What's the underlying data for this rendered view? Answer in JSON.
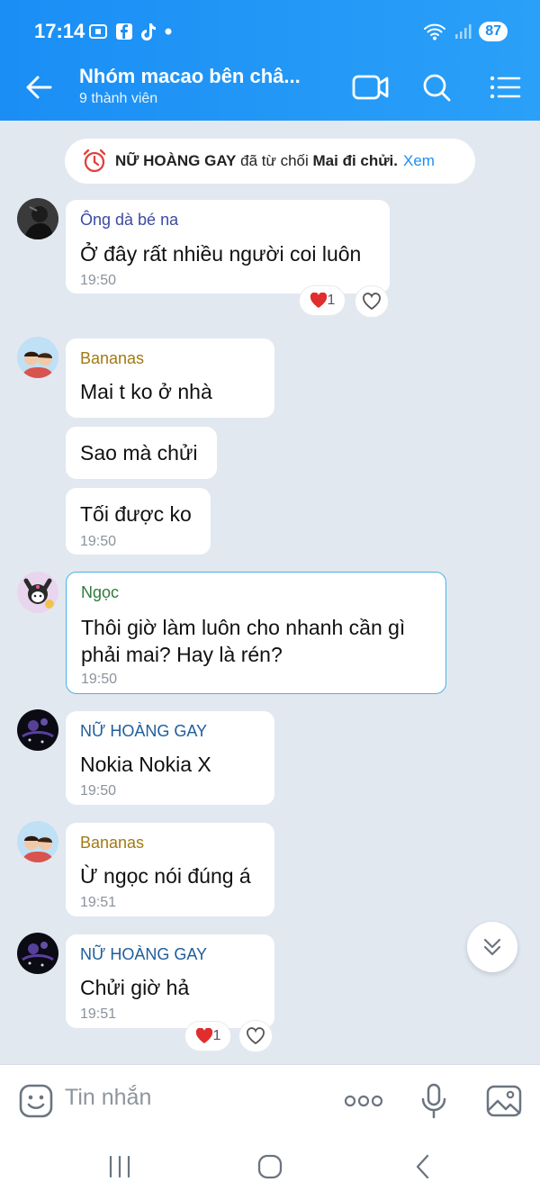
{
  "status_bar": {
    "time": "17:14",
    "battery": "87"
  },
  "header": {
    "title": "Nhóm macao bên châ...",
    "subtitle": "9 thành viên"
  },
  "system_message": {
    "actor": "NỮ HOÀNG GAY",
    "text": "đã từ chối",
    "target": "Mai đi chửi.",
    "link": "Xem"
  },
  "messages": [
    {
      "sender": "Ông dà bé na",
      "text": "Ở đây rất nhiều người coi luôn",
      "time": "19:50",
      "reaction_count": "1"
    },
    {
      "sender": "Bananas",
      "text": "Mai t ko ở nhà"
    },
    {
      "text": "Sao mà chửi"
    },
    {
      "text": "Tối được ko",
      "time": "19:50"
    },
    {
      "sender": "Ngọc",
      "text_line1": "Thôi giờ làm luôn cho nhanh cần gì",
      "text_line2": "phải mai? Hay là rén?",
      "time": "19:50"
    },
    {
      "sender": "NỮ HOÀNG GAY",
      "text": "Nokia Nokia X",
      "time": "19:50"
    },
    {
      "sender": "Bananas",
      "text": "Ừ ngọc nói đúng á",
      "time": "19:51"
    },
    {
      "sender": "NỮ HOÀNG GAY",
      "text": "Chửi giờ hả",
      "time": "19:51",
      "reaction_count": "1"
    }
  ],
  "input": {
    "placeholder": "Tin nhắn"
  },
  "colors": {
    "header": "#1a8ef5",
    "background": "#e2e8f0",
    "link": "#1a8ef5"
  }
}
